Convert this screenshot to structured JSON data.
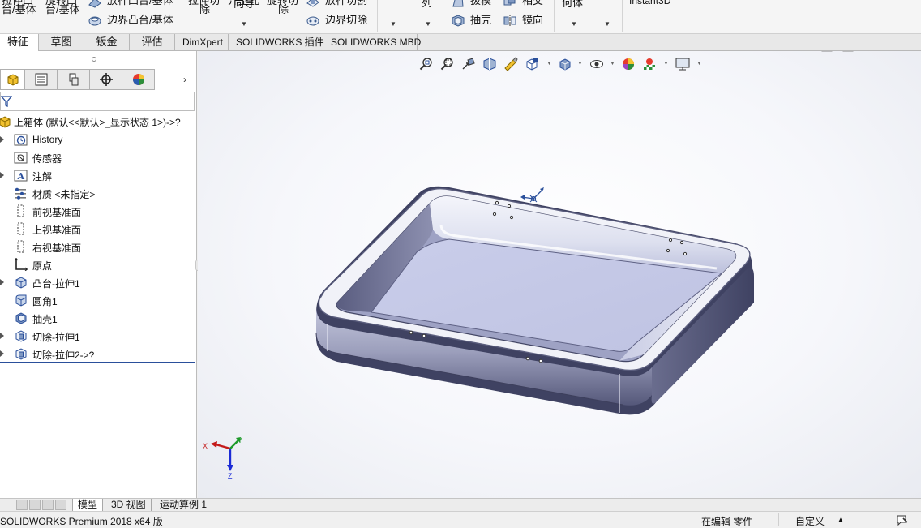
{
  "ribbon": {
    "col1_line1": "拉伸凸",
    "col1_line2": "台/基体",
    "col2_line1": "旋转凸",
    "col2_line2": "台/基体",
    "loft_boss": "放样凸台/基体",
    "boundary_boss": "边界凸台/基体",
    "extrude_cut_line1": "拉伸切",
    "extrude_cut_line2": "除",
    "hole_wizard_line1": "异型孔",
    "hole_wizard_line2": "向导",
    "revolve_cut_line1": "旋转切",
    "revolve_cut_line2": "除",
    "loft_cut": "放样切割",
    "boundary_cut": "边界切除",
    "pattern_label": "列",
    "draft": "拔模",
    "shell": "抽壳",
    "intersect": "相交",
    "mirror": "镜向",
    "ref_geometry": "何体",
    "instant3d": "Instant3D"
  },
  "tabs": [
    {
      "label": "特征",
      "active": true
    },
    {
      "label": "草图",
      "active": false
    },
    {
      "label": "钣金",
      "active": false
    },
    {
      "label": "评估",
      "active": false
    },
    {
      "label": "DimXpert",
      "active": false
    },
    {
      "label": "SOLIDWORKS 插件",
      "active": false
    },
    {
      "label": "SOLIDWORKS MBD",
      "active": false
    }
  ],
  "tree": {
    "root": "上箱体  (默认<<默认>_显示状态 1>)->?",
    "items": [
      {
        "label": "History",
        "icon": "history-icon",
        "expandable": true
      },
      {
        "label": "传感器",
        "icon": "sensor-icon",
        "expandable": false
      },
      {
        "label": "注解",
        "icon": "annotation-icon",
        "expandable": true
      },
      {
        "label": "材质 <未指定>",
        "icon": "material-icon",
        "expandable": false
      },
      {
        "label": "前视基准面",
        "icon": "plane-icon",
        "expandable": false
      },
      {
        "label": "上视基准面",
        "icon": "plane-icon",
        "expandable": false
      },
      {
        "label": "右视基准面",
        "icon": "plane-icon",
        "expandable": false
      },
      {
        "label": "原点",
        "icon": "origin-icon",
        "expandable": false
      },
      {
        "label": "凸台-拉伸1",
        "icon": "boss-extrude-icon",
        "expandable": true
      },
      {
        "label": "圆角1",
        "icon": "fillet-icon",
        "expandable": false
      },
      {
        "label": "抽壳1",
        "icon": "shell-icon",
        "expandable": false
      },
      {
        "label": "切除-拉伸1",
        "icon": "cut-extrude-icon",
        "expandable": true
      },
      {
        "label": "切除-拉伸2->?",
        "icon": "cut-extrude-icon",
        "expandable": true
      }
    ]
  },
  "triad": {
    "x": "X",
    "y": "Y",
    "z": "Z"
  },
  "sheet_tabs": [
    {
      "label": "模型",
      "active": true
    },
    {
      "label": "3D 视图",
      "active": false
    },
    {
      "label": "运动算例 1",
      "active": false
    }
  ],
  "status": {
    "product": "SOLIDWORKS Premium 2018 x64 版",
    "mode": "在编辑 零件",
    "units": "自定义",
    "units_caret": "▲"
  },
  "colors": {
    "accent_blue": "#2a4f9b",
    "model_face": "#c7cbe6",
    "model_dark": "#4b4e6e",
    "background": "#ffffff"
  }
}
